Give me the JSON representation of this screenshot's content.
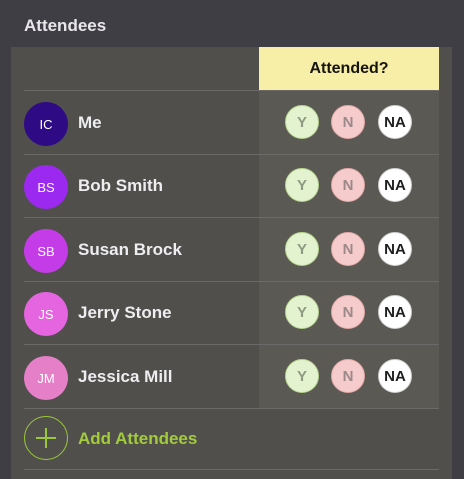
{
  "section_title": "Attendees",
  "column_header": "Attended?",
  "buttons": {
    "yes": "Y",
    "no": "N",
    "na": "NA"
  },
  "attendees": [
    {
      "initials": "IC",
      "name": "Me",
      "avatar_color": "#2f0a85"
    },
    {
      "initials": "BS",
      "name": "Bob Smith",
      "avatar_color": "#9b29f0"
    },
    {
      "initials": "SB",
      "name": "Susan Brock",
      "avatar_color": "#c43be8"
    },
    {
      "initials": "JS",
      "name": "Jerry Stone",
      "avatar_color": "#e565e0"
    },
    {
      "initials": "JM",
      "name": "Jessica Mill",
      "avatar_color": "#e57fc8"
    }
  ],
  "add_label": "Add Attendees",
  "accent_color": "#a2cc3c"
}
